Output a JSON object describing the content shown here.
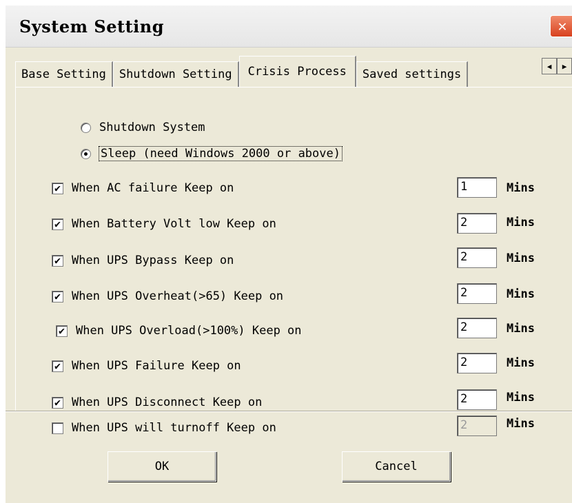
{
  "window": {
    "title": "System Setting",
    "close_glyph": "✕"
  },
  "tabs": [
    {
      "label": "Base Setting"
    },
    {
      "label": "Shutdown Setting"
    },
    {
      "label": "Crisis Process"
    },
    {
      "label": "Saved settings"
    }
  ],
  "tab_scroll": {
    "left": "◀",
    "right": "▶"
  },
  "action": {
    "options": [
      {
        "label": "Shutdown System",
        "selected": false
      },
      {
        "label": "Sleep (need Windows 2000 or above)",
        "selected": true
      }
    ]
  },
  "events": [
    {
      "label": "When AC failure Keep on",
      "checked": true,
      "minutes": "1",
      "unit": "Mins",
      "enabled": true
    },
    {
      "label": "When Battery Volt low Keep on",
      "checked": true,
      "minutes": "2",
      "unit": "Mins",
      "enabled": true
    },
    {
      "label": "When UPS Bypass Keep on",
      "checked": true,
      "minutes": "2",
      "unit": "Mins",
      "enabled": true
    },
    {
      "label": "When UPS Overheat(>65)  Keep on",
      "checked": true,
      "minutes": "2",
      "unit": "Mins",
      "enabled": true
    },
    {
      "label": "When UPS Overload(>100%) Keep on",
      "checked": true,
      "minutes": "2",
      "unit": "Mins",
      "enabled": true
    },
    {
      "label": "When UPS Failure  Keep on",
      "checked": true,
      "minutes": "2",
      "unit": "Mins",
      "enabled": true
    },
    {
      "label": "When UPS Disconnect  Keep on",
      "checked": true,
      "minutes": "2",
      "unit": "Mins",
      "enabled": true
    },
    {
      "label": "When UPS will turnoff  Keep on",
      "checked": false,
      "minutes": "2",
      "unit": "Mins",
      "enabled": false
    }
  ],
  "buttons": {
    "ok": "OK",
    "cancel": "Cancel"
  },
  "icons": {
    "checkmark": "✔"
  }
}
